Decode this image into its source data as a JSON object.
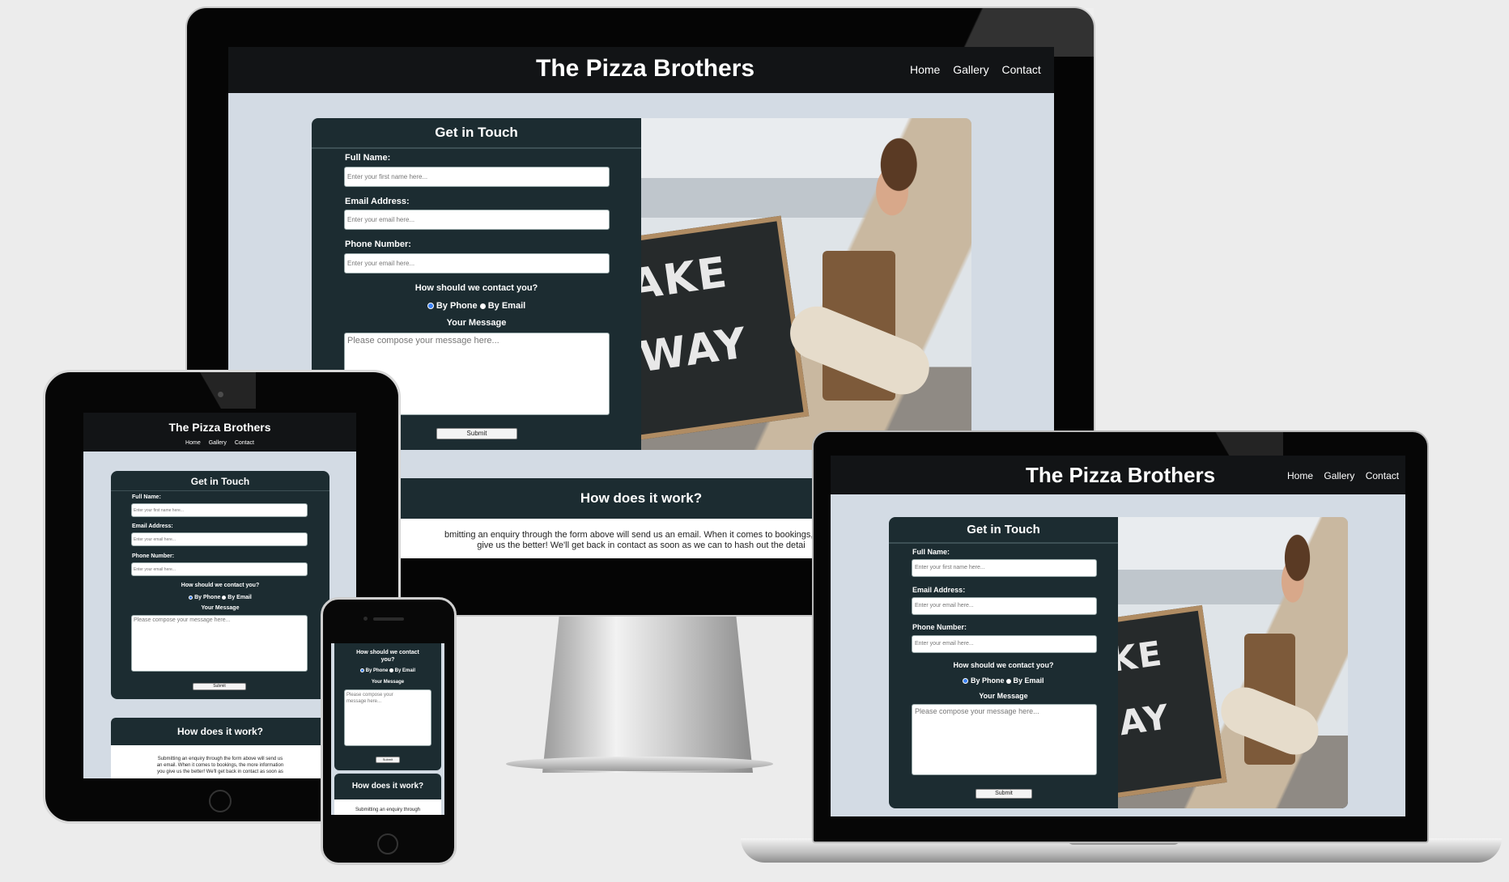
{
  "site": {
    "title": "The Pizza Brothers",
    "nav": [
      "Home",
      "Gallery",
      "Contact"
    ]
  },
  "form": {
    "heading": "Get in Touch",
    "full_name_label": "Full Name:",
    "full_name_placeholder": "Enter your first name here...",
    "email_label": "Email Address:",
    "email_placeholder": "Enter your email here...",
    "phone_label": "Phone Number:",
    "phone_placeholder": "Enter your email here...",
    "contact_question": "How should we contact you?",
    "option_phone": "By Phone",
    "option_email": "By Email",
    "message_label": "Your Message",
    "message_placeholder": "Please compose your message here...",
    "submit_label": "Submit"
  },
  "photo": {
    "board_line1": "AKE",
    "board_line2": "WAY",
    "board_line1_laptop": "KE",
    "board_line2_laptop": "AY"
  },
  "how": {
    "heading": "How does it work?",
    "monitor_line1": "bmitting an enquiry through the form above will send us an email. When it comes to bookings, the m",
    "monitor_line2": "give us the better! We'll get back in contact as soon as we can to hash out the detai",
    "tablet_line1": "Submitting an enquiry through the form above will send us",
    "tablet_line2": "an email. When it comes to bookings, the more information",
    "tablet_line3": "you give us the better! We'll get back in contact as soon as",
    "phone_line1": "Submitting an enquiry through"
  },
  "phone_form": {
    "contact_question_line1": "How should we contact",
    "contact_question_line2": "you?",
    "message_placeholder_line1": "Please compose your",
    "message_placeholder_line2": "message here..."
  },
  "colors": {
    "header_bg": "#121416",
    "card_bg": "#1c2c31",
    "page_bg": "#d3dbe4",
    "radio_selected": "#3b82f6"
  }
}
